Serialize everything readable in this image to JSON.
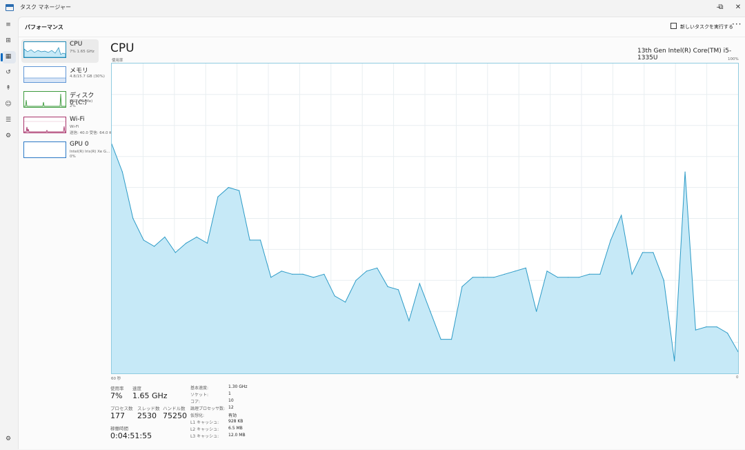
{
  "window": {
    "title": "タスク マネージャー",
    "minimize_glyph": "–",
    "restore_glyph": "⧉",
    "close_glyph": "✕"
  },
  "header": {
    "page_title": "パフォーマンス",
    "new_task_label": "新しいタスクを実行する",
    "more_glyph": "···"
  },
  "nav_icons": [
    "menu-icon",
    "processes-icon",
    "performance-icon",
    "app-history-icon",
    "startup-icon",
    "users-icon",
    "details-icon",
    "services-icon",
    "settings-icon"
  ],
  "sidebar": {
    "items": [
      {
        "name": "CPU",
        "line1": "7%  1.65 GHz",
        "line2": "",
        "color": "#1b88b6"
      },
      {
        "name": "メモリ",
        "line1": "4.8/15.7 GB (30%)",
        "line2": "",
        "color": "#6096d6"
      },
      {
        "name": "ディスク 0 (C:)",
        "line1": "SSD (NVMe)",
        "line2": "2%",
        "color": "#3c9b3c"
      },
      {
        "name": "Wi-Fi",
        "line1": "Wi-Fi",
        "line2": "送信: 40.0  受信: 64.0 Kb",
        "color": "#a8326a"
      },
      {
        "name": "GPU 0",
        "line1": "Intel(R) Iris(R) Xe G...",
        "line2": "0%",
        "color": "#2a78c6"
      }
    ]
  },
  "main": {
    "title": "CPU",
    "model": "13th Gen Intel(R) Core(TM) i5-1335U",
    "graph_ylabel": "使用率",
    "graph_ymax_label": "100%",
    "graph_xleft_label": "60 秒",
    "graph_xright_label": "0"
  },
  "stats": {
    "usage_label": "使用率",
    "usage_value": "7%",
    "speed_label": "速度",
    "speed_value": "1.65 GHz",
    "processes_label": "プロセス数",
    "processes_value": "177",
    "threads_label": "スレッド数",
    "threads_value": "2530",
    "handles_label": "ハンドル数",
    "handles_value": "75250",
    "uptime_label": "稼働時間",
    "uptime_value": "0:04:51:55"
  },
  "specs": [
    {
      "key": "基本速度:",
      "value": "1.30 GHz"
    },
    {
      "key": "ソケット:",
      "value": "1"
    },
    {
      "key": "コア:",
      "value": "10"
    },
    {
      "key": "論理プロセッサ数:",
      "value": "12"
    },
    {
      "key": "仮想化:",
      "value": "有効"
    },
    {
      "key": "L1 キャッシュ:",
      "value": "928 KB"
    },
    {
      "key": "L2 キャッシュ:",
      "value": "6.5 MB"
    },
    {
      "key": "L3 キャッシュ:",
      "value": "12.0 MB"
    }
  ],
  "chart_data": {
    "type": "area",
    "ylim": [
      0,
      100
    ],
    "xlim": [
      60,
      0
    ],
    "grid": true,
    "values": [
      74,
      65,
      50,
      43,
      41,
      44,
      39,
      42,
      44,
      42,
      57,
      60,
      59,
      43,
      43,
      31,
      33,
      32,
      32,
      31,
      32,
      25,
      23,
      30,
      33,
      34,
      28,
      27,
      17,
      29,
      20,
      11,
      11,
      28,
      31,
      31,
      31,
      32,
      33,
      34,
      20,
      33,
      31,
      31,
      31,
      32,
      32,
      43,
      51,
      32,
      39,
      39,
      30,
      4,
      65,
      14,
      15,
      15,
      13,
      7
    ],
    "colors": {
      "line": "#2b9ac6",
      "fill": "#c6e9f7",
      "grid": "#e8eef1"
    }
  }
}
